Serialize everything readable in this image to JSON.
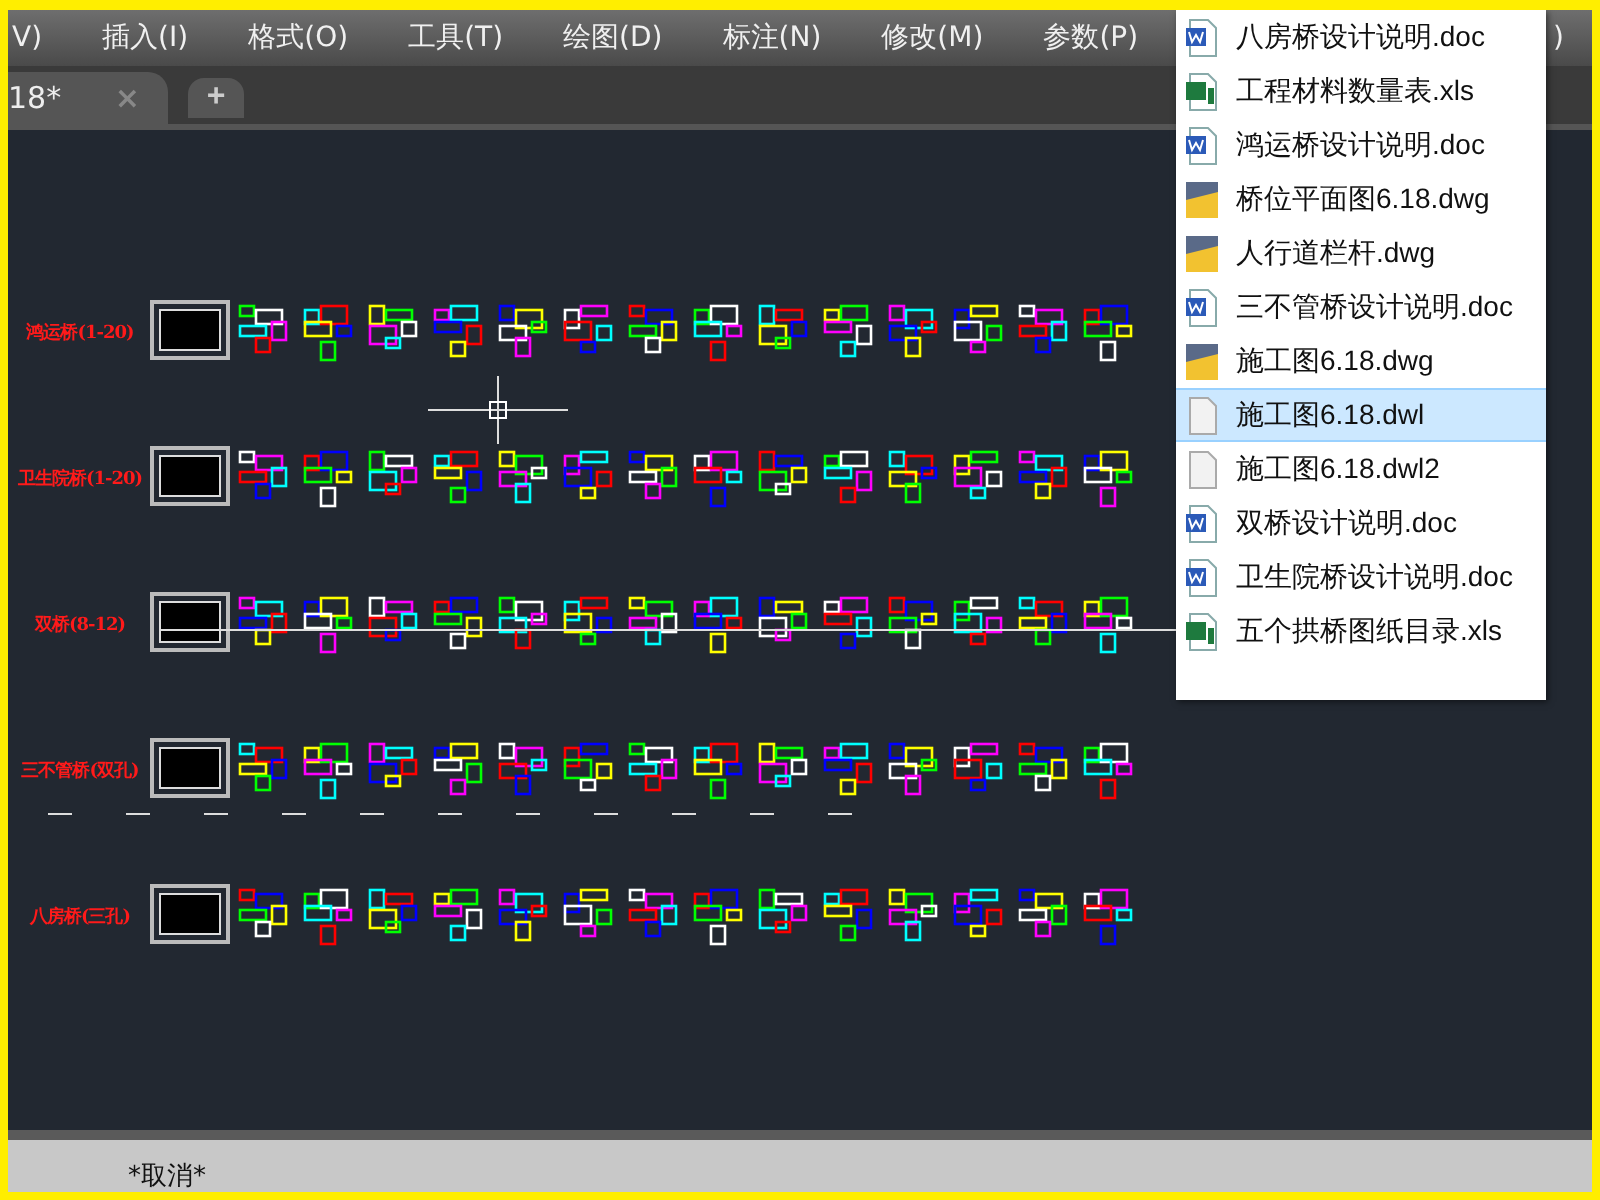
{
  "menu": [
    {
      "label": "V)"
    },
    {
      "label": "插入(I)"
    },
    {
      "label": "格式(O)"
    },
    {
      "label": "工具(T)"
    },
    {
      "label": "绘图(D)"
    },
    {
      "label": "标注(N)"
    },
    {
      "label": "修改(M)"
    },
    {
      "label": "参数(P)"
    },
    {
      "label": ")"
    }
  ],
  "tabs": [
    {
      "label": "18*",
      "selected": true,
      "close": "×"
    }
  ],
  "new_tab": "+",
  "drawing_rows": [
    {
      "label": "鸿运桥(1-20)"
    },
    {
      "label": "卫生院桥(1-20)"
    },
    {
      "label": "双桥(8-12)"
    },
    {
      "label": "三不管桥(双孔)"
    },
    {
      "label": "八房桥(三孔)"
    }
  ],
  "command_line": "*取消*",
  "file_list": [
    {
      "name": "八房桥设计说明.doc",
      "kind": "doc",
      "selected": false
    },
    {
      "name": "工程材料数量表.xls",
      "kind": "xls",
      "selected": false
    },
    {
      "name": "鸿运桥设计说明.doc",
      "kind": "doc",
      "selected": false
    },
    {
      "name": "桥位平面图6.18.dwg",
      "kind": "dwg",
      "selected": false
    },
    {
      "name": "人行道栏杆.dwg",
      "kind": "dwg",
      "selected": false
    },
    {
      "name": "三不管桥设计说明.doc",
      "kind": "doc",
      "selected": false
    },
    {
      "name": "施工图6.18.dwg",
      "kind": "dwg",
      "selected": false
    },
    {
      "name": "施工图6.18.dwl",
      "kind": "file",
      "selected": true
    },
    {
      "name": "施工图6.18.dwl2",
      "kind": "file",
      "selected": false
    },
    {
      "name": "双桥设计说明.doc",
      "kind": "doc",
      "selected": false
    },
    {
      "name": "卫生院桥设计说明.doc",
      "kind": "doc",
      "selected": false
    },
    {
      "name": "五个拱桥图纸目录.xls",
      "kind": "xls",
      "selected": false
    }
  ]
}
